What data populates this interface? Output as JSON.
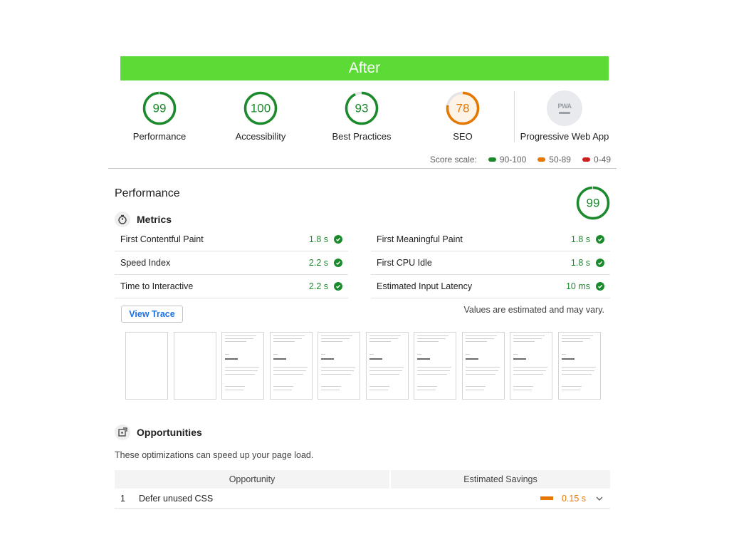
{
  "banner": {
    "title": "After"
  },
  "gauges": [
    {
      "score": "99",
      "label": "Performance",
      "value": 0.99,
      "color": "#1b8a2c"
    },
    {
      "score": "100",
      "label": "Accessibility",
      "value": 1.0,
      "color": "#1b8a2c"
    },
    {
      "score": "93",
      "label": "Best Practices",
      "value": 0.93,
      "color": "#1b8a2c"
    },
    {
      "score": "78",
      "label": "SEO",
      "value": 0.78,
      "color": "#e67700"
    }
  ],
  "pwa": {
    "badge": "PWA",
    "label": "Progressive Web App",
    "icon": "pwa-badge-icon"
  },
  "score_scale": {
    "label": "Score scale:",
    "ranges": [
      {
        "text": "90-100",
        "color": "#1b8a2c"
      },
      {
        "text": "50-89",
        "color": "#e67700"
      },
      {
        "text": "0-49",
        "color": "#cc1f1f"
      }
    ]
  },
  "performance": {
    "title": "Performance",
    "score": "99",
    "score_value": 0.99,
    "metrics_title": "Metrics",
    "metrics_icon": "stopwatch-icon",
    "metrics_left": [
      {
        "name": "First Contentful Paint",
        "value": "1.8 s"
      },
      {
        "name": "Speed Index",
        "value": "2.2 s"
      },
      {
        "name": "Time to Interactive",
        "value": "2.2 s"
      }
    ],
    "metrics_right": [
      {
        "name": "First Meaningful Paint",
        "value": "1.8 s"
      },
      {
        "name": "First CPU Idle",
        "value": "1.8 s"
      },
      {
        "name": "Estimated Input Latency",
        "value": "10 ms"
      }
    ],
    "view_trace_label": "View Trace",
    "estimate_note": "Values are estimated and may vary."
  },
  "filmstrip": {
    "frames": [
      false,
      false,
      true,
      true,
      true,
      true,
      true,
      true,
      true,
      true
    ]
  },
  "opportunities": {
    "title": "Opportunities",
    "icon": "opportunity-icon",
    "description": "These optimizations can speed up your page load.",
    "col_opportunity": "Opportunity",
    "col_savings": "Estimated Savings",
    "rows": [
      {
        "index": "1",
        "name": "Defer unused CSS",
        "savings": "0.15 s"
      }
    ]
  },
  "colors": {
    "pass": "#1b8a2c",
    "average": "#e67700",
    "fail": "#cc1f1f",
    "banner": "#5cdb36"
  }
}
